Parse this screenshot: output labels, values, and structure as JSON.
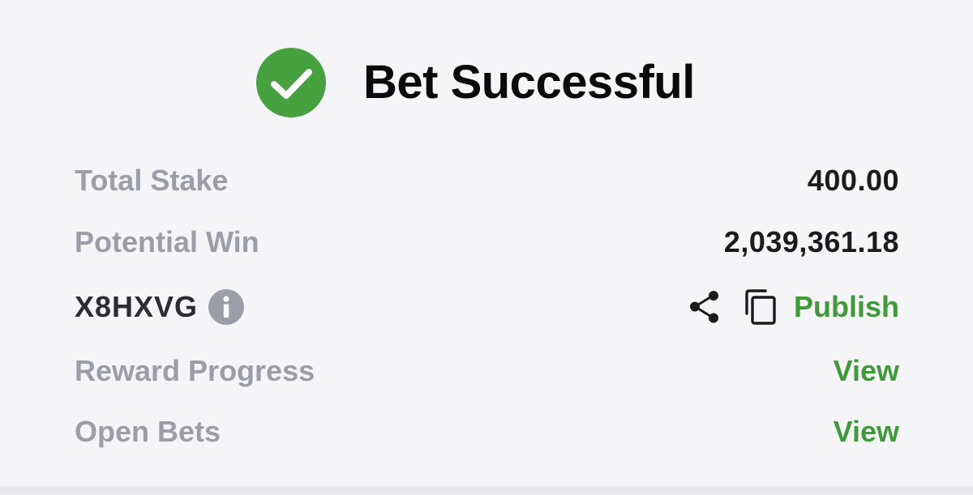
{
  "header": {
    "title": "Bet Successful",
    "icon": "check-circle-icon",
    "icon_color": "#45a23f"
  },
  "summary": {
    "total_stake_label": "Total Stake",
    "total_stake_value": "400.00",
    "potential_win_label": "Potential Win",
    "potential_win_value": "2,039,361.18"
  },
  "booking": {
    "code": "X8HXVG",
    "info_icon": "info-icon",
    "share_icon": "share-icon",
    "copy_icon": "copy-icon",
    "publish_label": "Publish"
  },
  "links": {
    "reward_progress_label": "Reward Progress",
    "reward_progress_action": "View",
    "open_bets_label": "Open Bets",
    "open_bets_action": "View"
  },
  "colors": {
    "accent_green": "#3f9a3a",
    "label_gray": "#9b9ea7",
    "text_dark": "#1b1b1f",
    "background": "#f5f5f7"
  }
}
